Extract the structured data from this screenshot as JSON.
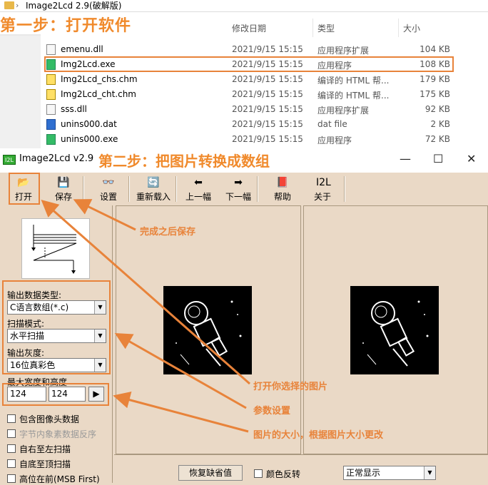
{
  "explorer": {
    "title": "Image2Lcd 2.9(破解版)",
    "step_label": "第一步：打开软件",
    "columns": [
      "修改日期",
      "类型",
      "大小"
    ],
    "files": [
      {
        "name": "emenu.dll",
        "date": "2021/9/15 15:15",
        "type": "应用程序扩展",
        "size": "104 KB",
        "icon": "dll-icon"
      },
      {
        "name": "Img2Lcd.exe",
        "date": "2021/9/15 15:15",
        "type": "应用程序",
        "size": "108 KB",
        "icon": "exe-icon"
      },
      {
        "name": "Img2Lcd_chs.chm",
        "date": "2021/9/15 15:15",
        "type": "编译的 HTML 帮...",
        "size": "179 KB",
        "icon": "chm-icon"
      },
      {
        "name": "Img2Lcd_cht.chm",
        "date": "2021/9/15 15:15",
        "type": "编译的 HTML 帮...",
        "size": "175 KB",
        "icon": "chm-icon"
      },
      {
        "name": "sss.dll",
        "date": "2021/9/15 15:15",
        "type": "应用程序扩展",
        "size": "92 KB",
        "icon": "dll-icon"
      },
      {
        "name": "unins000.dat",
        "date": "2021/9/15 15:15",
        "type": "dat file",
        "size": "2 KB",
        "icon": "dat-icon"
      },
      {
        "name": "unins000.exe",
        "date": "2021/9/15 15:15",
        "type": "应用程序",
        "size": "72 KB",
        "icon": "exe-icon"
      }
    ]
  },
  "app": {
    "title": "Image2Lcd v2.9",
    "logo_text": "I2L",
    "step_label": "第二步：把图片转换成数组",
    "toolbar": [
      {
        "label": "打开",
        "icon": "open-folder-icon",
        "glyph": "📂"
      },
      {
        "label": "保存",
        "icon": "save-disk-icon",
        "glyph": "💾"
      },
      {
        "label": "设置",
        "icon": "settings-glasses-icon",
        "glyph": "👓"
      },
      {
        "label": "重新载入",
        "icon": "reload-icon",
        "glyph": "🔄"
      },
      {
        "label": "上一幅",
        "icon": "prev-arrow-icon",
        "glyph": "⬅"
      },
      {
        "label": "下一幅",
        "icon": "next-arrow-icon",
        "glyph": "➡"
      },
      {
        "label": "帮助",
        "icon": "help-book-icon",
        "glyph": "📕"
      },
      {
        "label": "关于",
        "icon": "about-logo-icon",
        "glyph": "I2L"
      }
    ],
    "settings": {
      "output_type_label": "输出数据类型:",
      "output_type_value": "C语言数组(*.c)",
      "scan_mode_label": "扫描模式:",
      "scan_mode_value": "水平扫描",
      "gray_label": "输出灰度:",
      "gray_value": "16位真彩色",
      "size_label": "最大宽度和高度",
      "width_value": "124",
      "height_value": "124",
      "size_btn": "▶"
    },
    "checkboxes": [
      {
        "label": "包含图像头数据",
        "enabled": true
      },
      {
        "label": "字节内象素数据反序",
        "enabled": false
      },
      {
        "label": "自右至左扫描",
        "enabled": true
      },
      {
        "label": "自底至顶扫描",
        "enabled": true
      },
      {
        "label": "高位在前(MSB First)",
        "enabled": true
      }
    ],
    "bottom": {
      "restore_btn": "恢复缺省值",
      "invert_label": "颜色反转",
      "display_mode": "正常显示"
    }
  },
  "annotations": {
    "save_note": "完成之后保存",
    "open_note": "打开你选择的图片",
    "params_note": "参数设置",
    "size_note": "图片的大小，根据图片大小更改"
  },
  "colors": {
    "accent": "#e8833a",
    "window_bg": "#ead9c6"
  }
}
